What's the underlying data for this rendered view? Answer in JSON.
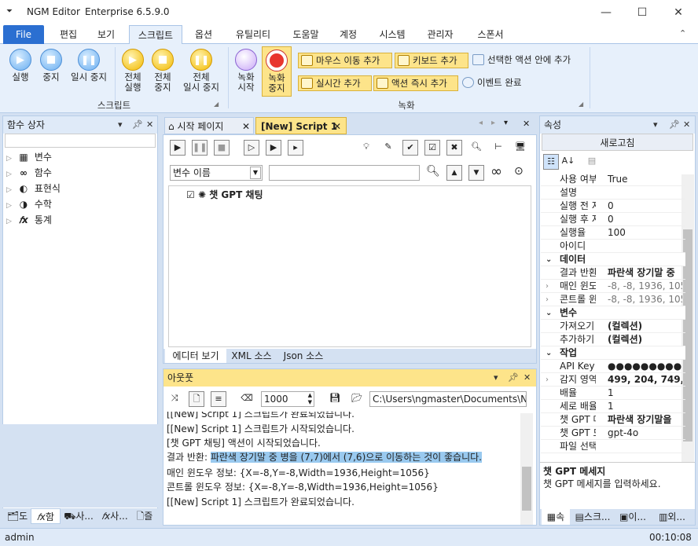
{
  "window": {
    "app_name": "NGM Editor",
    "edition": "Enterprise 6.5.9.0",
    "minimize": "—",
    "maximize": "☐",
    "close": "✕"
  },
  "ribbon_tabs": [
    "File",
    "편집",
    "보기",
    "스크립트",
    "옵션",
    "유틸리티",
    "도움말",
    "계정",
    "시스템",
    "관리자",
    "스폰서"
  ],
  "active_tab": "스크립트",
  "script_group": {
    "run": "실행",
    "stop": "중지",
    "pause": "일시 중지",
    "run_all": [
      "전체",
      "실행"
    ],
    "stop_all": [
      "전체",
      "중지"
    ],
    "pause_all": [
      "전체",
      "일시 중지"
    ],
    "label": "스크립트"
  },
  "record_group": {
    "record_start": [
      "녹화",
      "시작"
    ],
    "record_stop": [
      "녹화",
      "중지"
    ],
    "add_mouse": "마우스 이동 추가",
    "add_keyboard": "키보드 추가",
    "add_in_selected": "선택한 액션 안에 추가",
    "add_realtime": "실시간 추가",
    "add_action_now": "액션 즉시 추가",
    "event_done": "이벤트 완료",
    "label": "녹화"
  },
  "function_panel": {
    "title": "함수 상자",
    "items": [
      {
        "label": "변수",
        "icon": "▦"
      },
      {
        "label": "함수",
        "icon": "∞"
      },
      {
        "label": "표현식",
        "icon": "◐"
      },
      {
        "label": "수학",
        "icon": "◑"
      },
      {
        "label": "통계",
        "icon": "𝑓x"
      }
    ],
    "bottom_tabs": [
      "도",
      "함",
      "사...",
      "사...",
      "즐"
    ]
  },
  "doc_tabs": [
    {
      "label": "시작 페이지"
    },
    {
      "label": "[New] Script 1"
    }
  ],
  "editor": {
    "var_select": "변수 이름",
    "tree_item": "챗 GPT 채팅",
    "bottom_tabs": [
      "에디터 보기",
      "XML 소스",
      "Json 소스"
    ]
  },
  "output_panel": {
    "title": "아웃풋",
    "count": "1000",
    "path": "C:\\Users\\ngmaster\\Documents\\NGM",
    "lines": [
      {
        "text": "[[New] Script 1] 스크립트가 완료되었습니다."
      },
      {
        "text": "[[New] Script 1] 스크립트가 시작되었습니다."
      },
      {
        "text": "[챗 GPT 채팅] 액션이 시작되었습니다."
      },
      {
        "prefix": "결과 반환: ",
        "text": "파란색 장기말 중 병을 (7,7)에서 (7,6)으로 이동하는 것이 좋습니다."
      },
      {
        "text": "매인 윈도우 정보: {X=-8,Y=-8,Width=1936,Height=1056}"
      },
      {
        "text": "콘트롤 윈도우 정보: {X=-8,Y=-8,Width=1936,Height=1056}"
      },
      {
        "text": "[[New] Script 1] 스크립트가 완료되었습니다."
      }
    ]
  },
  "props_panel": {
    "title": "속성",
    "refresh": "새로고침",
    "rows": [
      {
        "k": "사용 여부",
        "v": "True"
      },
      {
        "k": "설명",
        "v": ""
      },
      {
        "k": "실행 전 지",
        "v": "0"
      },
      {
        "k": "실행 후 지",
        "v": "0"
      },
      {
        "k": "실행율",
        "v": "100"
      },
      {
        "k": "아이디",
        "v": ""
      },
      {
        "cat": "데이터"
      },
      {
        "k": "결과 반환",
        "v": "파란색 장기말 중",
        "bold": true
      },
      {
        "k": "매인 윈도:",
        "v": "-8, -8, 1936, 1056",
        "gray": true,
        "exp": true
      },
      {
        "k": "콘트롤 윈!",
        "v": "-8, -8, 1936, 1056",
        "gray": true,
        "exp": true
      },
      {
        "cat": "변수"
      },
      {
        "k": "가져오기",
        "v": "(컬렉션)",
        "bold": true
      },
      {
        "k": "추가하기",
        "v": "(컬렉션)",
        "bold": true
      },
      {
        "cat": "작업"
      },
      {
        "k": "API Key 입",
        "v": "●●●●●●●●●"
      },
      {
        "k": "감지 영역",
        "v": "499, 204, 749, 7",
        "bold": true,
        "exp": true
      },
      {
        "k": "배율",
        "v": "1"
      },
      {
        "k": "세로 배율",
        "v": "1"
      },
      {
        "k": "챗 GPT 메",
        "v": "파란색 장기말을",
        "bold": true
      },
      {
        "k": "챗 GPT 모",
        "v": "gpt-4o"
      },
      {
        "k": "파일 선택",
        "v": ""
      }
    ],
    "desc_title": "챗 GPT 메세지",
    "desc_text": "챗 GPT 메세지를 입력하세요.",
    "bottom_tabs": [
      "속",
      "스크...",
      "이...",
      "외..."
    ]
  },
  "status": {
    "user": "admin",
    "time": "00:10:08"
  }
}
